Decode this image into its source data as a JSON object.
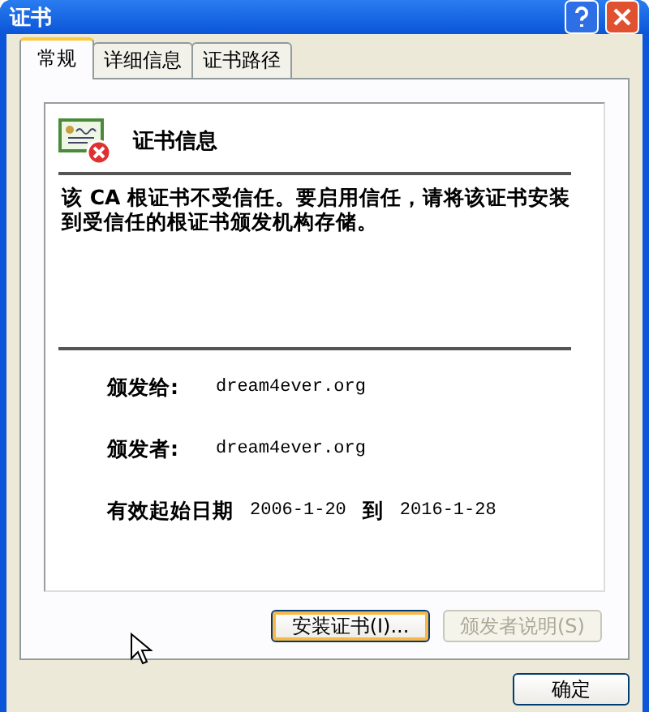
{
  "window": {
    "title": "证书"
  },
  "tabs": [
    {
      "label": "常规",
      "selected": true
    },
    {
      "label": "详细信息",
      "selected": false
    },
    {
      "label": "证书路径",
      "selected": false
    }
  ],
  "header": {
    "title": "证书信息"
  },
  "message": "该 CA 根证书不受信任。要启用信任，请将该证书安装到受信任的根证书颁发机构存储。",
  "fields": [
    {
      "label": "颁发给:",
      "value": "dream4ever.org"
    },
    {
      "label": "颁发者:",
      "value": "dream4ever.org"
    }
  ],
  "validity": {
    "label": "有效起始日期",
    "from": "2006-1-20",
    "to_label": "到",
    "to": "2016-1-28"
  },
  "buttons": [
    {
      "label": "安装证书(I)...",
      "disabled": false,
      "focused": true
    },
    {
      "label": "颁发者说明(S)",
      "disabled": true,
      "focused": false
    }
  ],
  "ok_button": {
    "label": "确定"
  }
}
